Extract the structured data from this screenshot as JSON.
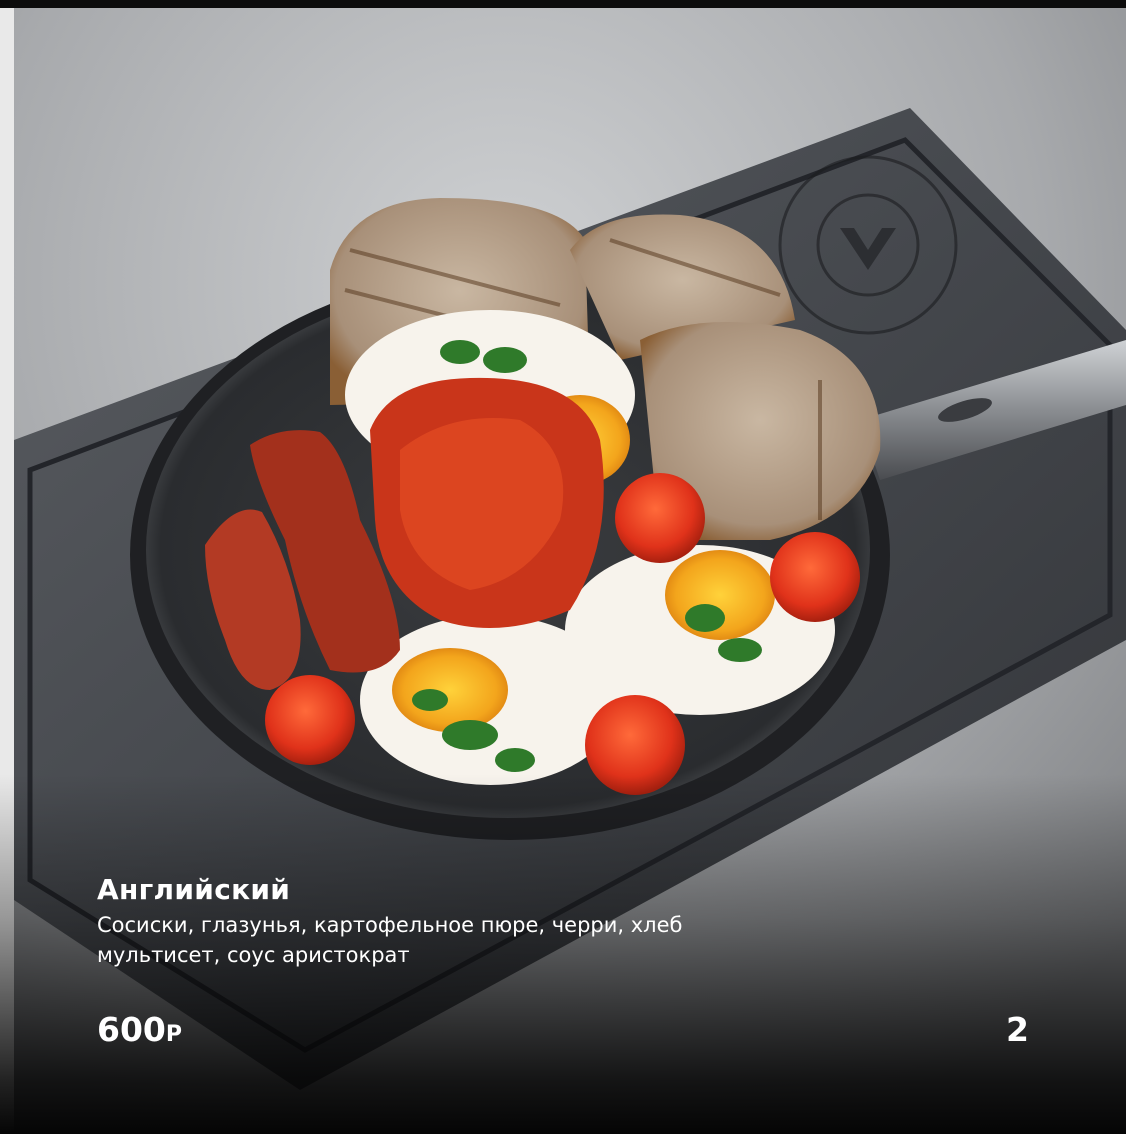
{
  "dish": {
    "title": "Английский",
    "description": "Сосиски, глазунья, картофельное пюре, черри, хлеб мультисет, соус аристократ",
    "price_value": "600",
    "price_currency": "Р",
    "quantity": "2"
  },
  "colors": {
    "background": "#a9abae",
    "board": "#4a4d52",
    "pan": "#2b2d30",
    "text": "#ffffff"
  }
}
